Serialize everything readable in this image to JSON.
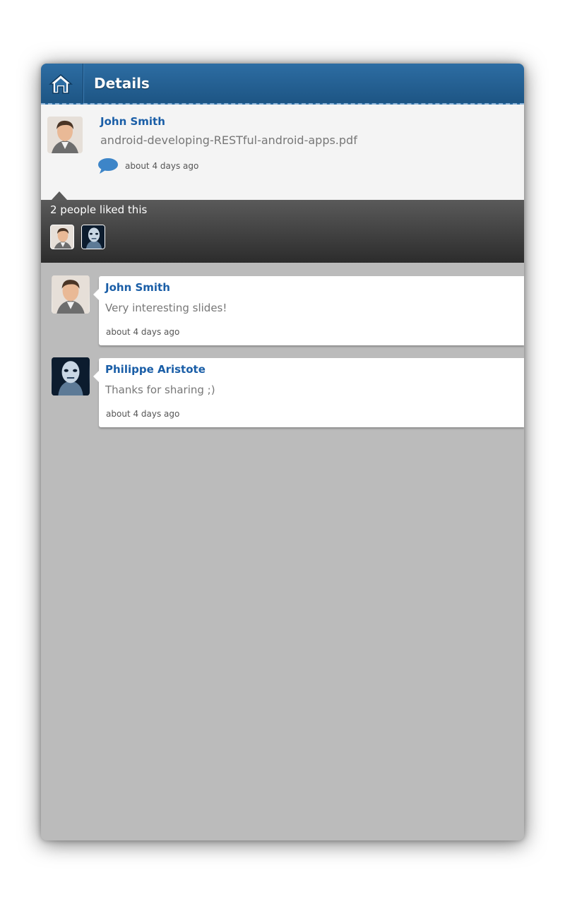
{
  "header": {
    "title": "Details",
    "home_icon": "home-icon",
    "colors": {
      "bar": "#1d5584",
      "title": "#ffffff"
    }
  },
  "detail": {
    "author": "John Smith",
    "file": "android-developing-RESTful-android-apps.pdf",
    "time": "about 4 days ago",
    "comment_icon": "speech-bubble-icon"
  },
  "likes": {
    "text": "2 people liked this",
    "users": [
      "John Smith",
      "Philippe Aristote"
    ]
  },
  "comments": [
    {
      "author": "John Smith",
      "text": "Very interesting slides!",
      "time": "about 4 days ago"
    },
    {
      "author": "Philippe Aristote",
      "text": "Thanks for sharing ;)",
      "time": "about 4 days ago"
    }
  ],
  "colors": {
    "author_link": "#1a5ea7",
    "background": "#bbbbbb",
    "likes_band": "#3a3a3a"
  }
}
